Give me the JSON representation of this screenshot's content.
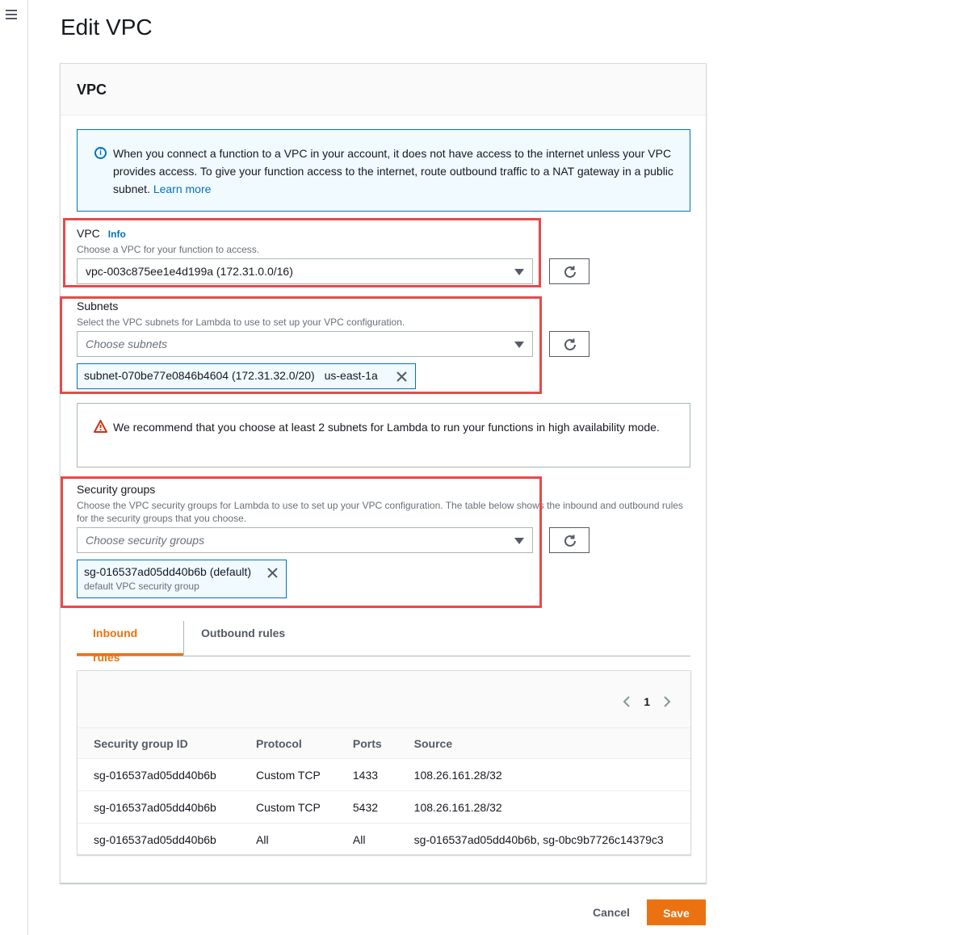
{
  "page": {
    "title": "Edit VPC"
  },
  "card": {
    "title": "VPC"
  },
  "info_alert": {
    "text": "When you connect a function to a VPC in your account, it does not have access to the internet unless your VPC provides access. To give your function access to the internet, route outbound traffic to a NAT gateway in a public subnet.",
    "link": "Learn more"
  },
  "vpc": {
    "label": "VPC",
    "info": "Info",
    "description": "Choose a VPC for your function to access.",
    "selected": "vpc-003c875ee1e4d199a (172.31.0.0/16)"
  },
  "subnets": {
    "label": "Subnets",
    "description": "Select the VPC subnets for Lambda to use to set up your VPC configuration.",
    "placeholder": "Choose subnets",
    "token_id": "subnet-070be77e0846b4604 (172.31.32.0/20)",
    "token_zone": "us-east-1a"
  },
  "warning": {
    "text": "We recommend that you choose at least 2 subnets for Lambda to run your functions in high availability mode."
  },
  "security_groups": {
    "label": "Security groups",
    "description": "Choose the VPC security groups for Lambda to use to set up your VPC configuration. The table below shows the inbound and outbound rules for the security groups that you choose.",
    "placeholder": "Choose security groups",
    "token_name": "sg-016537ad05dd40b6b (default)",
    "token_desc": "default VPC security group"
  },
  "tabs": {
    "inbound": "Inbound rules",
    "outbound": "Outbound rules"
  },
  "table": {
    "page": "1",
    "headers": [
      "Security group ID",
      "Protocol",
      "Ports",
      "Source"
    ],
    "rows": [
      [
        "sg-016537ad05dd40b6b",
        "Custom TCP",
        "1433",
        "108.26.161.28/32"
      ],
      [
        "sg-016537ad05dd40b6b",
        "Custom TCP",
        "5432",
        "108.26.161.28/32"
      ],
      [
        "sg-016537ad05dd40b6b",
        "All",
        "All",
        "sg-016537ad05dd40b6b, sg-0bc9b7726c14379c3"
      ]
    ]
  },
  "footer": {
    "cancel": "Cancel",
    "save": "Save"
  },
  "colors": {
    "accent": "#ec7211",
    "link": "#0073bb",
    "highlight": "#e8494a",
    "warning": "#d13212"
  }
}
